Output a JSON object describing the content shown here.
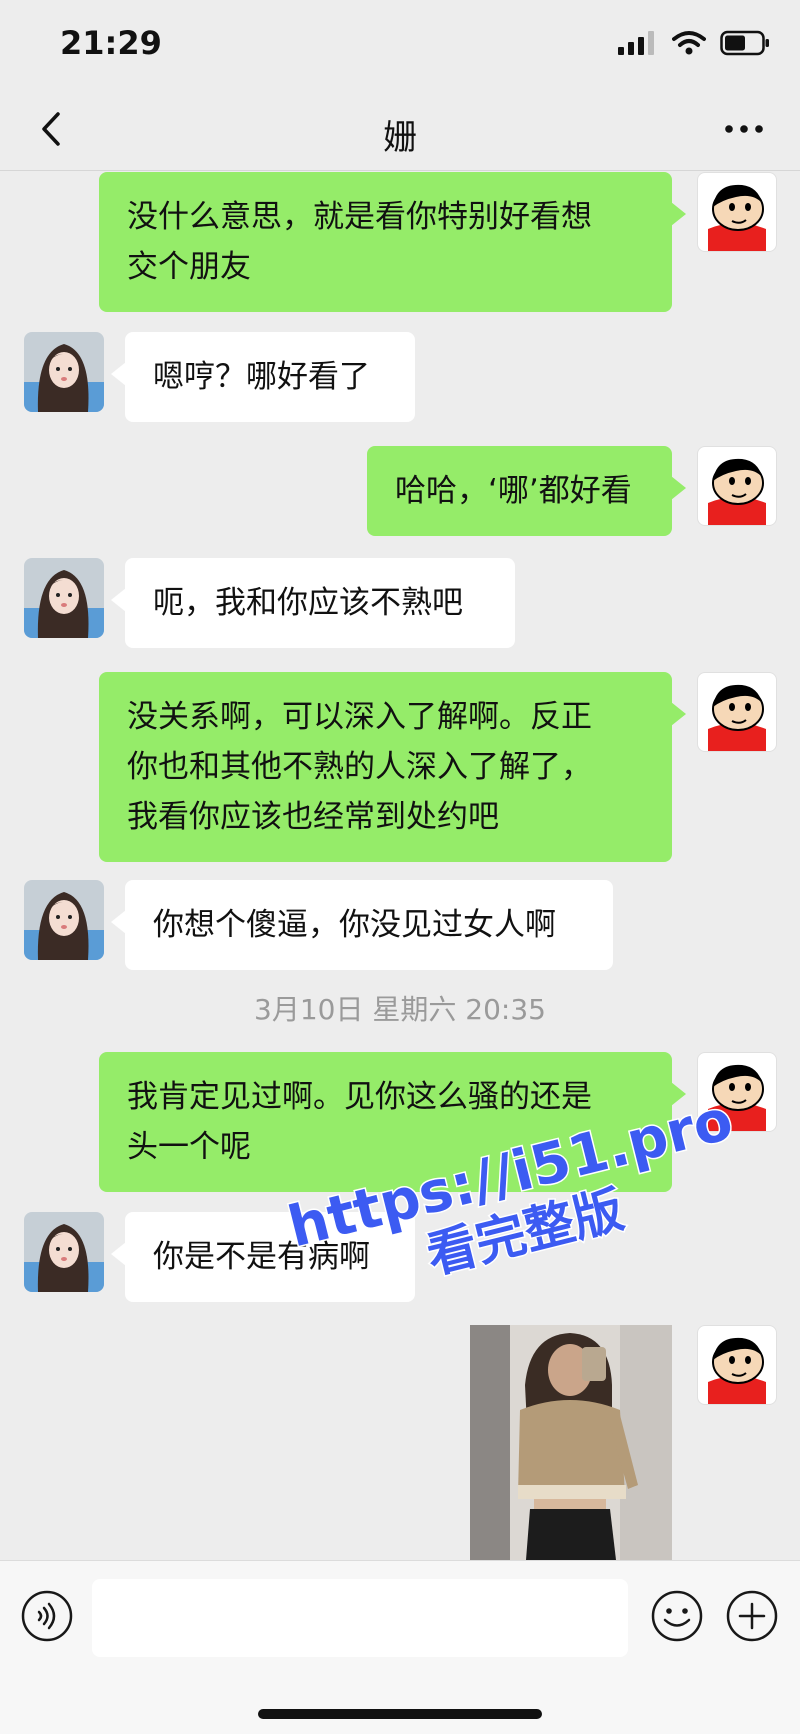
{
  "status_bar": {
    "time": "21:29"
  },
  "header": {
    "title": "姗"
  },
  "messages": [
    {
      "from": "me",
      "lines": [
        "没什么意思，就是看你特别好看想",
        "交个朋友"
      ]
    },
    {
      "from": "them",
      "lines": [
        "嗯哼？哪好看了"
      ]
    },
    {
      "from": "me",
      "lines": [
        "哈哈，‘哪’都好看"
      ]
    },
    {
      "from": "them",
      "lines": [
        "呃，我和你应该不熟吧"
      ]
    },
    {
      "from": "me",
      "lines": [
        "没关系啊，可以深入了解啊。反正",
        "你也和其他不熟的人深入了解了，",
        "我看你应该也经常到处约吧"
      ]
    },
    {
      "from": "them",
      "lines": [
        "你想个傻逼，你没见过女人啊"
      ]
    },
    {
      "from": "me",
      "lines": [
        "我肯定见过啊。见你这么骚的还是",
        "头一个呢"
      ]
    },
    {
      "from": "them",
      "lines": [
        "你是不是有病啊"
      ]
    }
  ],
  "timestamp": "3月10日 星期六 20:35",
  "watermark": {
    "line1": "https://i51.pro",
    "line2": "看完整版"
  },
  "colors": {
    "my_bubble": "#95ec69",
    "their_bubble": "#ffffff",
    "background": "#ededed",
    "watermark": "#3c5bf2"
  },
  "icons": {
    "back": "chevron-left-icon",
    "more": "more-dots-icon",
    "voice": "voice-icon",
    "emoji": "emoji-icon",
    "plus": "plus-icon"
  }
}
